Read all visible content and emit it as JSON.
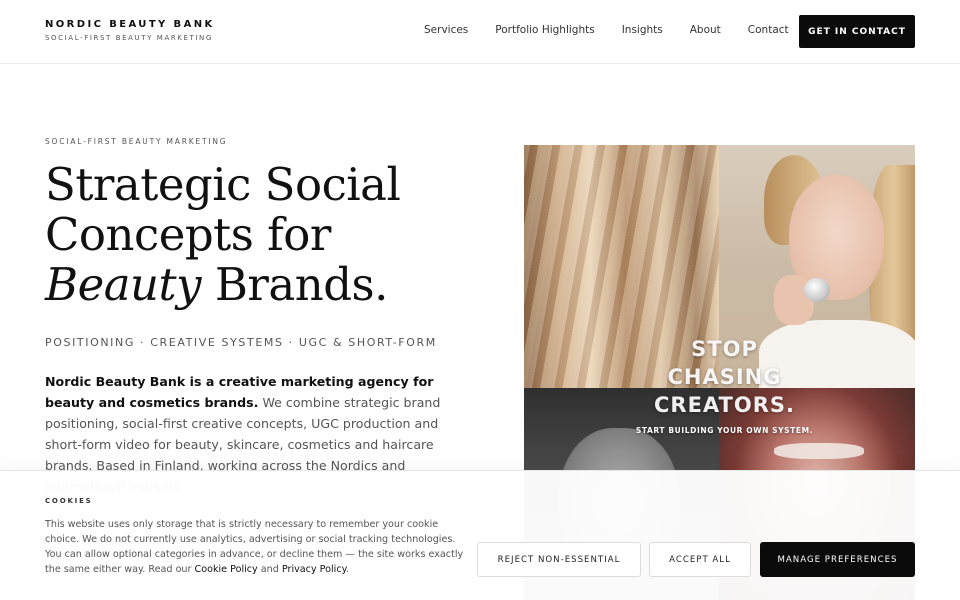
{
  "header": {
    "brand_name": "NORDIC BEAUTY BANK",
    "brand_tagline": "SOCIAL-FIRST BEAUTY MARKETING",
    "nav": [
      "Services",
      "Portfolio Highlights",
      "Insights",
      "About",
      "Contact"
    ],
    "cta_label": "GET IN CONTACT"
  },
  "hero": {
    "eyebrow": "SOCIAL-FIRST BEAUTY MARKETING",
    "headline_line1": "Strategic Social",
    "headline_line2": "Concepts for",
    "headline_italic": "Beauty",
    "headline_end": " Brands.",
    "pillars": "POSITIONING · CREATIVE SYSTEMS · UGC & SHORT-FORM",
    "intro_bold": "Nordic Beauty Bank is a creative marketing agency for beauty and cosmetics brands.",
    "intro_rest": " We combine strategic brand positioning, social-first creative concepts, UGC production and short-form video for beauty, skincare, cosmetics and haircare brands. Based in Finland, working across the Nordics and international markets.",
    "image_overlay_lines": [
      "STOP",
      "CHASING",
      "CREATORS."
    ],
    "image_overlay_sub": "START BUILDING YOUR OWN SYSTEM."
  },
  "cookie": {
    "title": "COOKIES",
    "text": "This website uses only storage that is strictly necessary to remember your cookie choice. We do not currently use analytics, advertising or social tracking technologies. You can allow optional categories in advance, or decline them — the site works exactly the same either way. Read our ",
    "link1": "Cookie Policy",
    "and": " and ",
    "link2": "Privacy Policy",
    "end": ".",
    "reject_label": "REJECT NON-ESSENTIAL",
    "accept_label": "ACCEPT ALL",
    "manage_label": "MANAGE PREFERENCES"
  }
}
